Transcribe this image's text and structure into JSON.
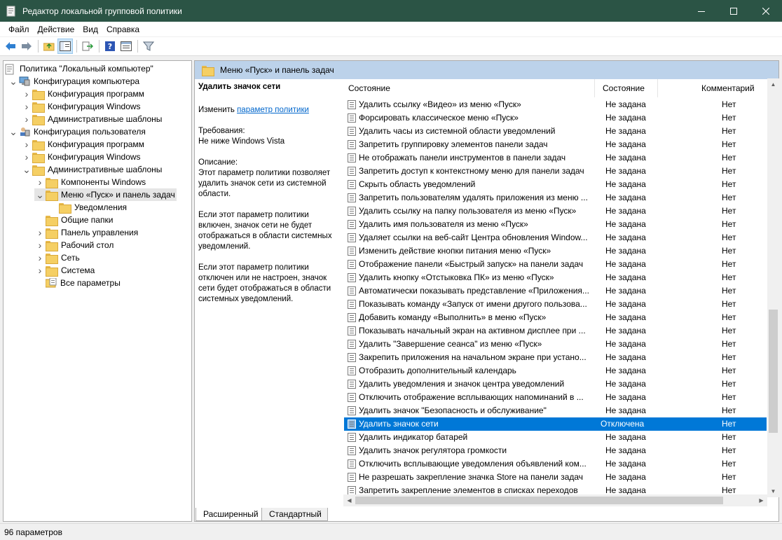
{
  "window": {
    "title": "Редактор локальной групповой политики",
    "controls": [
      "minimize",
      "maximize",
      "close"
    ]
  },
  "menubar": {
    "items": [
      {
        "label": "Файл"
      },
      {
        "label": "Действие"
      },
      {
        "label": "Вид"
      },
      {
        "label": "Справка"
      }
    ]
  },
  "toolbar": {
    "icons": [
      "back-arrow-icon",
      "forward-arrow-icon",
      "up-folder-icon",
      "show-hide-tree-icon",
      "export-list-icon",
      "help-icon",
      "extended-view-icon",
      "filter-icon"
    ]
  },
  "tree": {
    "items": [
      {
        "label": "Политика \"Локальный компьютер\"",
        "level": 0,
        "arrow": "",
        "icon": "policy-doc-icon"
      },
      {
        "label": "Конфигурация компьютера",
        "level": 1,
        "arrow": "expanded",
        "icon": "computer-icon"
      },
      {
        "label": "Конфигурация программ",
        "level": 2,
        "arrow": "collapsed",
        "icon": "folder-icon"
      },
      {
        "label": "Конфигурация Windows",
        "level": 2,
        "arrow": "collapsed",
        "icon": "folder-icon"
      },
      {
        "label": "Административные шаблоны",
        "level": 2,
        "arrow": "collapsed",
        "icon": "folder-icon"
      },
      {
        "label": "Конфигурация пользователя",
        "level": 1,
        "arrow": "expanded",
        "icon": "user-icon"
      },
      {
        "label": "Конфигурация программ",
        "level": 2,
        "arrow": "collapsed",
        "icon": "folder-icon"
      },
      {
        "label": "Конфигурация Windows",
        "level": 2,
        "arrow": "collapsed",
        "icon": "folder-icon"
      },
      {
        "label": "Административные шаблоны",
        "level": 2,
        "arrow": "expanded",
        "icon": "folder-icon"
      },
      {
        "label": "Компоненты Windows",
        "level": 3,
        "arrow": "collapsed",
        "icon": "folder-icon"
      },
      {
        "label": "Меню «Пуск» и панель задач",
        "level": 3,
        "arrow": "expanded",
        "icon": "folder-icon",
        "selected": true
      },
      {
        "label": "Уведомления",
        "level": 4,
        "arrow": "",
        "icon": "folder-icon"
      },
      {
        "label": "Общие папки",
        "level": 3,
        "arrow": "",
        "icon": "folder-icon"
      },
      {
        "label": "Панель управления",
        "level": 3,
        "arrow": "collapsed",
        "icon": "folder-icon"
      },
      {
        "label": "Рабочий стол",
        "level": 3,
        "arrow": "collapsed",
        "icon": "folder-icon"
      },
      {
        "label": "Сеть",
        "level": 3,
        "arrow": "collapsed",
        "icon": "folder-icon"
      },
      {
        "label": "Система",
        "level": 3,
        "arrow": "collapsed",
        "icon": "folder-icon"
      },
      {
        "label": "Все параметры",
        "level": 3,
        "arrow": "",
        "icon": "all-settings-icon"
      }
    ]
  },
  "right_header": {
    "title": "Меню «Пуск» и панель задач"
  },
  "description": {
    "title": "Удалить значок сети",
    "edit_prefix": "Изменить",
    "edit_link": "параметр политики",
    "req_label": "Требования:",
    "req_value": "Не ниже Windows Vista",
    "desc_label": "Описание:",
    "p1": "Этот параметр политики позволяет удалить значок сети из системной области.",
    "p2": "Если этот параметр политики включен, значок сети не будет отображаться в области системных уведомлений.",
    "p3": "Если этот параметр политики отключен или не настроен, значок сети будет отображаться в области системных уведомлений."
  },
  "list": {
    "columns": {
      "name": "Состояние",
      "state": "Состояние",
      "comment": "Комментарий"
    },
    "rows": [
      {
        "name": "Удалить ссылку «Видео» из меню «Пуск»",
        "state": "Не задана",
        "comment": "Нет"
      },
      {
        "name": "Форсировать классическое меню «Пуск»",
        "state": "Не задана",
        "comment": "Нет"
      },
      {
        "name": "Удалить часы из системной области уведомлений",
        "state": "Не задана",
        "comment": "Нет"
      },
      {
        "name": "Запретить группировку элементов панели задач",
        "state": "Не задана",
        "comment": "Нет"
      },
      {
        "name": "Не отображать панели инструментов в панели задач",
        "state": "Не задана",
        "comment": "Нет"
      },
      {
        "name": "Запретить доступ к контекстному меню для панели задач",
        "state": "Не задана",
        "comment": "Нет"
      },
      {
        "name": "Скрыть область уведомлений",
        "state": "Не задана",
        "comment": "Нет"
      },
      {
        "name": "Запретить пользователям удалять приложения из меню ...",
        "state": "Не задана",
        "comment": "Нет"
      },
      {
        "name": "Удалить ссылку на папку пользователя из меню «Пуск»",
        "state": "Не задана",
        "comment": "Нет"
      },
      {
        "name": "Удалить имя пользователя из меню «Пуск»",
        "state": "Не задана",
        "comment": "Нет"
      },
      {
        "name": "Удаляет ссылки на веб-сайт Центра обновления Window...",
        "state": "Не задана",
        "comment": "Нет"
      },
      {
        "name": "Изменить действие кнопки питания меню «Пуск»",
        "state": "Не задана",
        "comment": "Нет"
      },
      {
        "name": "Отображение панели «Быстрый запуск» на панели задач",
        "state": "Не задана",
        "comment": "Нет"
      },
      {
        "name": "Удалить кнопку «Отстыковка ПК» из меню «Пуск»",
        "state": "Не задана",
        "comment": "Нет"
      },
      {
        "name": "Автоматически показывать представление «Приложения...",
        "state": "Не задана",
        "comment": "Нет"
      },
      {
        "name": "Показывать команду «Запуск от имени другого пользова...",
        "state": "Не задана",
        "comment": "Нет"
      },
      {
        "name": "Добавить команду «Выполнить» в меню «Пуск»",
        "state": "Не задана",
        "comment": "Нет"
      },
      {
        "name": "Показывать начальный экран на активном дисплее при ...",
        "state": "Не задана",
        "comment": "Нет"
      },
      {
        "name": "Удалить \"Завершение сеанса\" из меню «Пуск»",
        "state": "Не задана",
        "comment": "Нет"
      },
      {
        "name": "Закрепить приложения на начальном экране при устано...",
        "state": "Не задана",
        "comment": "Нет"
      },
      {
        "name": "Отобразить дополнительный календарь",
        "state": "Не задана",
        "comment": "Нет"
      },
      {
        "name": "Удалить уведомления и значок центра уведомлений",
        "state": "Не задана",
        "comment": "Нет"
      },
      {
        "name": "Отключить отображение всплывающих напоминаний в ...",
        "state": "Не задана",
        "comment": "Нет"
      },
      {
        "name": "Удалить значок \"Безопасность и обслуживание\"",
        "state": "Не задана",
        "comment": "Нет"
      },
      {
        "name": "Удалить значок сети",
        "state": "Отключена",
        "comment": "Нет",
        "selected": true
      },
      {
        "name": "Удалить индикатор батарей",
        "state": "Не задана",
        "comment": "Нет"
      },
      {
        "name": "Удалить значок регулятора громкости",
        "state": "Не задана",
        "comment": "Нет"
      },
      {
        "name": "Отключить всплывающие уведомления объявлений ком...",
        "state": "Не задана",
        "comment": "Нет"
      },
      {
        "name": "Не разрешать закрепление значка Store на панели задач",
        "state": "Не задана",
        "comment": "Нет"
      },
      {
        "name": "Запретить закрепление элементов в списках переходов",
        "state": "Не задана",
        "comment": "Нет"
      }
    ]
  },
  "tabs": [
    {
      "label": "Расширенный"
    },
    {
      "label": "Стандартный"
    }
  ],
  "status": {
    "text": "96 параметров"
  }
}
